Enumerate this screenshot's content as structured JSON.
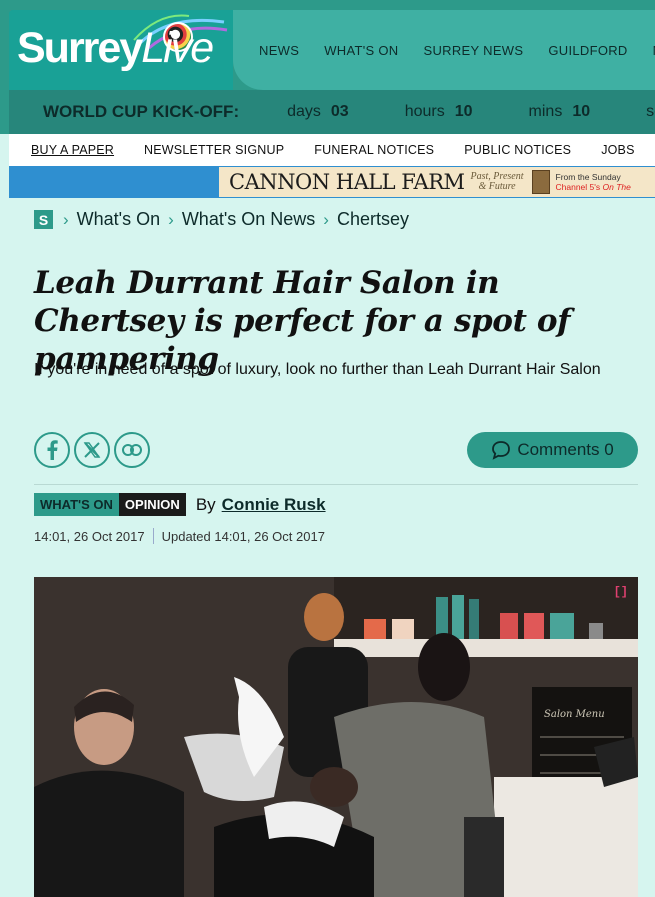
{
  "header": {
    "logo": {
      "main": "Surrey",
      "accent": "Live"
    },
    "nav": [
      "NEWS",
      "WHAT'S ON",
      "SURREY NEWS",
      "GUILDFORD",
      "MO"
    ]
  },
  "countdown": {
    "title": "WORLD CUP KICK-OFF:",
    "units": [
      {
        "label": "days",
        "value": "03"
      },
      {
        "label": "hours",
        "value": "10"
      },
      {
        "label": "mins",
        "value": "10"
      },
      {
        "label": "sec",
        "value": ""
      }
    ]
  },
  "subnav": [
    "BUY A PAPER",
    "NEWSLETTER SIGNUP",
    "FUNERAL NOTICES",
    "PUBLIC NOTICES",
    "JOBS",
    "PI"
  ],
  "ad": {
    "title": "CANNON HALL FARM",
    "tagline_1": "Past, Present",
    "tagline_2": "& Future",
    "right_1": "From the Sunday",
    "right_2_plain": "Channel 5's ",
    "right_2_italic": "On The"
  },
  "breadcrumb": {
    "badge": "S",
    "items": [
      "What's On",
      "What's On News",
      "Chertsey"
    ]
  },
  "article": {
    "headline": "Leah Durrant Hair Salon in Chertsey is perfect for a spot of pampering",
    "standfirst": "If you're in need of a spot of luxury, look no further than Leah Durrant Hair Salon",
    "comments_label": "Comments 0",
    "section_tag": "WHAT'S ON",
    "type_tag": "OPINION",
    "by": "By",
    "author": "Connie Rusk",
    "published": "14:01, 26 Oct 2017",
    "updated": "Updated 14:01, 26 Oct 2017",
    "expand_icon_text": "[]"
  },
  "share": [
    "facebook-icon",
    "x-icon",
    "link-icon"
  ],
  "colors": {
    "brand": "#2d9a8a",
    "page_bg": "#d6f5ef",
    "ad_bar": "#2f8fd0"
  }
}
